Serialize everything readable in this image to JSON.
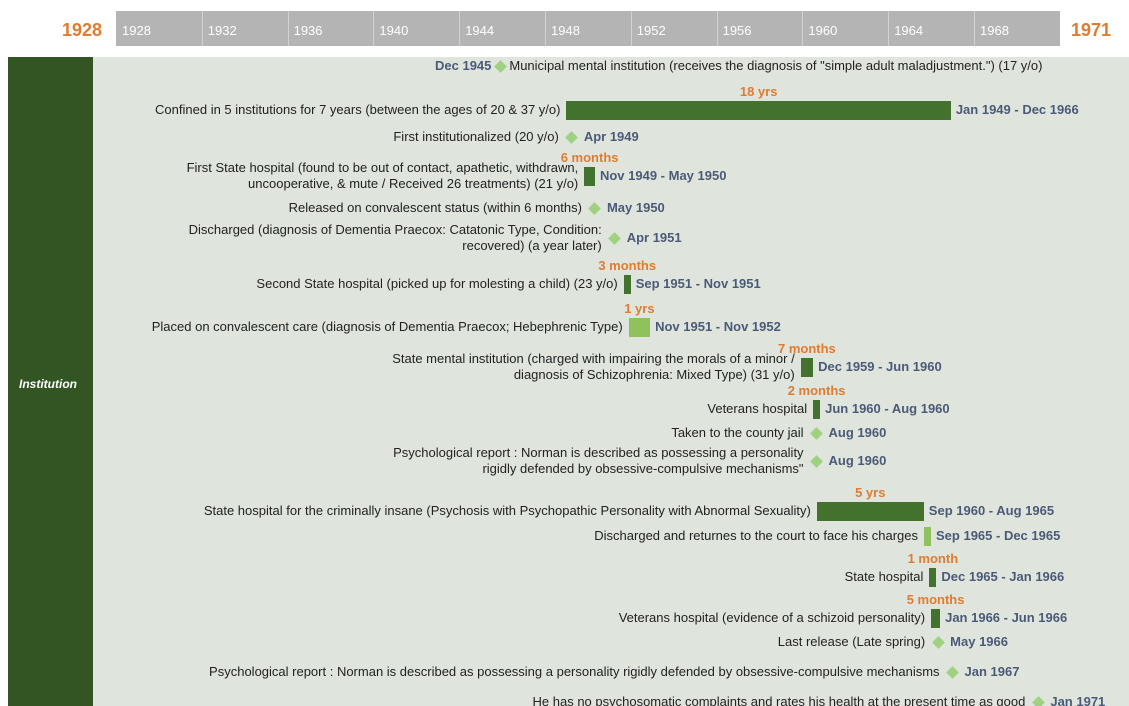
{
  "timeline": {
    "range_start": "1928",
    "range_end": "1971",
    "ticks": [
      "1928",
      "1932",
      "1936",
      "1940",
      "1944",
      "1948",
      "1952",
      "1956",
      "1960",
      "1964",
      "1968"
    ],
    "group": "Institution"
  },
  "colors": {
    "bar_dark": "#43722f",
    "bar_light": "#8fc25c",
    "diamond": "#9fd180",
    "accent": "#e07b31",
    "date": "#4a5a78",
    "group": "#335524"
  },
  "events": [
    {
      "label": "Municipal mental institution (receives the diagnosis of \"simple adult maladjustment.\") (17 y/o)",
      "date": "Dec 1945",
      "duration": "",
      "start": 1945.92,
      "end": 1945.92,
      "kind": "milestone",
      "label_side": "right",
      "color": "light"
    },
    {
      "label": "Confined in 5 institutions for 7 years (between the ages of 20 & 37 y/o)",
      "date": "Jan 1949 - Dec 1966",
      "duration": "18 yrs",
      "start": 1949.0,
      "end": 1966.92,
      "kind": "bar",
      "label_side": "left",
      "color": "dark"
    },
    {
      "label": "First institutionalized (20 y/o)",
      "date": "Apr 1949",
      "duration": "",
      "start": 1949.25,
      "end": 1949.25,
      "kind": "milestone",
      "label_side": "left",
      "color": "light"
    },
    {
      "label": "First State hospital (found to be out of contact, apathetic, withdrawn, uncooperative, & mute / Received 26 treatments) (21 y/o)",
      "date": "Nov 1949 - May 1950",
      "duration": "6 months",
      "start": 1949.83,
      "end": 1950.33,
      "kind": "bar",
      "label_side": "left",
      "color": "dark"
    },
    {
      "label": "Released on convalescent status (within 6 months)",
      "date": "May 1950",
      "duration": "",
      "start": 1950.33,
      "end": 1950.33,
      "kind": "milestone",
      "label_side": "left",
      "color": "light"
    },
    {
      "label": "Discharged (diagnosis of Dementia Praecox: Catatonic Type, Condition: recovered) (a year later)",
      "date": "Apr 1951",
      "duration": "",
      "start": 1951.25,
      "end": 1951.25,
      "kind": "milestone",
      "label_side": "left",
      "color": "light"
    },
    {
      "label": "Second State hospital (picked up for molesting a child) (23 y/o)",
      "date": "Sep 1951 - Nov 1951",
      "duration": "3 months",
      "start": 1951.67,
      "end": 1951.9,
      "kind": "bar",
      "label_side": "left",
      "color": "dark"
    },
    {
      "label": "Placed on convalescent care (diagnosis of Dementia Praecox; Hebephrenic Type)",
      "date": "Nov 1951 - Nov 1952",
      "duration": "1 yrs",
      "start": 1951.9,
      "end": 1952.9,
      "kind": "bar",
      "label_side": "left",
      "color": "light"
    },
    {
      "label": "State mental institution (charged with impairing the morals of a minor / diagnosis of Schizophrenia: Mixed Type) (31 y/o)",
      "date": "Dec 1959 - Jun 1960",
      "duration": "7 months",
      "start": 1959.92,
      "end": 1960.5,
      "kind": "bar",
      "label_side": "left",
      "color": "dark"
    },
    {
      "label": "Veterans hospital",
      "date": "Jun 1960 - Aug 1960",
      "duration": "2 months",
      "start": 1960.5,
      "end": 1960.66,
      "kind": "bar",
      "label_side": "left",
      "color": "dark"
    },
    {
      "label": "Taken to the county jail",
      "date": "Aug 1960",
      "duration": "",
      "start": 1960.66,
      "end": 1960.66,
      "kind": "milestone",
      "label_side": "left",
      "color": "light"
    },
    {
      "label": "Psychological report : Norman is described as possessing a personality rigidly defended by obsessive-compulsive mechanisms\"",
      "date": "Aug 1960",
      "duration": "",
      "start": 1960.66,
      "end": 1960.66,
      "kind": "milestone",
      "label_side": "left",
      "color": "light"
    },
    {
      "label": "State hospital for the criminally insane (Psychosis with Psychopathic Personality with Abnormal Sexuality)",
      "date": "Sep 1960 - Aug 1965",
      "duration": "5 yrs",
      "start": 1960.67,
      "end": 1965.66,
      "kind": "bar",
      "label_side": "left",
      "color": "dark"
    },
    {
      "label": "Discharged and returnes to the court to face his charges",
      "date": "Sep 1965 - Dec 1965",
      "duration": "",
      "start": 1965.67,
      "end": 1965.92,
      "kind": "bar",
      "label_side": "left",
      "color": "light"
    },
    {
      "label": "State hospital",
      "date": "Dec 1965 - Jan 1966",
      "duration": "1 month",
      "start": 1965.92,
      "end": 1966.08,
      "kind": "bar",
      "label_side": "left",
      "color": "dark"
    },
    {
      "label": "Veterans hospital (evidence of a schizoid personality)",
      "date": "Jan 1966 - Jun 1966",
      "duration": "5 months",
      "start": 1966.0,
      "end": 1966.42,
      "kind": "bar",
      "label_side": "left",
      "color": "dark"
    },
    {
      "label": "Last release (Late spring)",
      "date": "May 1966",
      "duration": "",
      "start": 1966.33,
      "end": 1966.33,
      "kind": "milestone",
      "label_side": "left",
      "color": "light"
    },
    {
      "label": "Psychological report : Norman is described as possessing a personality rigidly defended by obsessive-compulsive mechanisms",
      "date": "Jan 1967",
      "duration": "",
      "start": 1967.0,
      "end": 1967.0,
      "kind": "milestone",
      "label_side": "left",
      "color": "light"
    },
    {
      "label": "He has no psychosomatic complaints and rates his health at the present time as good",
      "date": "Jan 1971",
      "duration": "",
      "start": 1971.0,
      "end": 1971.0,
      "kind": "milestone",
      "label_side": "left",
      "color": "light"
    }
  ],
  "chart_data": {
    "type": "bar",
    "x_axis": "year",
    "xlim": [
      1928,
      1971
    ],
    "tick_labels": [
      "1928",
      "1932",
      "1936",
      "1940",
      "1944",
      "1948",
      "1952",
      "1956",
      "1960",
      "1964",
      "1968"
    ],
    "group": "Institution",
    "series": [
      {
        "label": "Confined in 5 institutions for 7 years (between the ages of 20 & 37 y/o)",
        "start": "Jan 1949",
        "end": "Dec 1966",
        "duration": "18 yrs"
      },
      {
        "label": "First State hospital",
        "start": "Nov 1949",
        "end": "May 1950",
        "duration": "6 months"
      },
      {
        "label": "Second State hospital",
        "start": "Sep 1951",
        "end": "Nov 1951",
        "duration": "3 months"
      },
      {
        "label": "Placed on convalescent care",
        "start": "Nov 1951",
        "end": "Nov 1952",
        "duration": "1 yrs"
      },
      {
        "label": "State mental institution",
        "start": "Dec 1959",
        "end": "Jun 1960",
        "duration": "7 months"
      },
      {
        "label": "Veterans hospital",
        "start": "Jun 1960",
        "end": "Aug 1960",
        "duration": "2 months"
      },
      {
        "label": "State hospital for the criminally insane",
        "start": "Sep 1960",
        "end": "Aug 1965",
        "duration": "5 yrs"
      },
      {
        "label": "Discharged and returnes to the court to face his charges",
        "start": "Sep 1965",
        "end": "Dec 1965",
        "duration": ""
      },
      {
        "label": "State hospital",
        "start": "Dec 1965",
        "end": "Jan 1966",
        "duration": "1 month"
      },
      {
        "label": "Veterans hospital (evidence of a schizoid personality)",
        "start": "Jan 1966",
        "end": "Jun 1966",
        "duration": "5 months"
      }
    ],
    "milestones": [
      {
        "label": "Municipal mental institution",
        "date": "Dec 1945"
      },
      {
        "label": "First institutionalized (20 y/o)",
        "date": "Apr 1949"
      },
      {
        "label": "Released on convalescent status (within 6 months)",
        "date": "May 1950"
      },
      {
        "label": "Discharged",
        "date": "Apr 1951"
      },
      {
        "label": "Taken to the county jail",
        "date": "Aug 1960"
      },
      {
        "label": "Psychological report",
        "date": "Aug 1960"
      },
      {
        "label": "Last release (Late spring)",
        "date": "May 1966"
      },
      {
        "label": "Psychological report",
        "date": "Jan 1967"
      },
      {
        "label": "He has no psychosomatic complaints and rates his health at the present time as good",
        "date": "Jan 1971"
      }
    ]
  }
}
